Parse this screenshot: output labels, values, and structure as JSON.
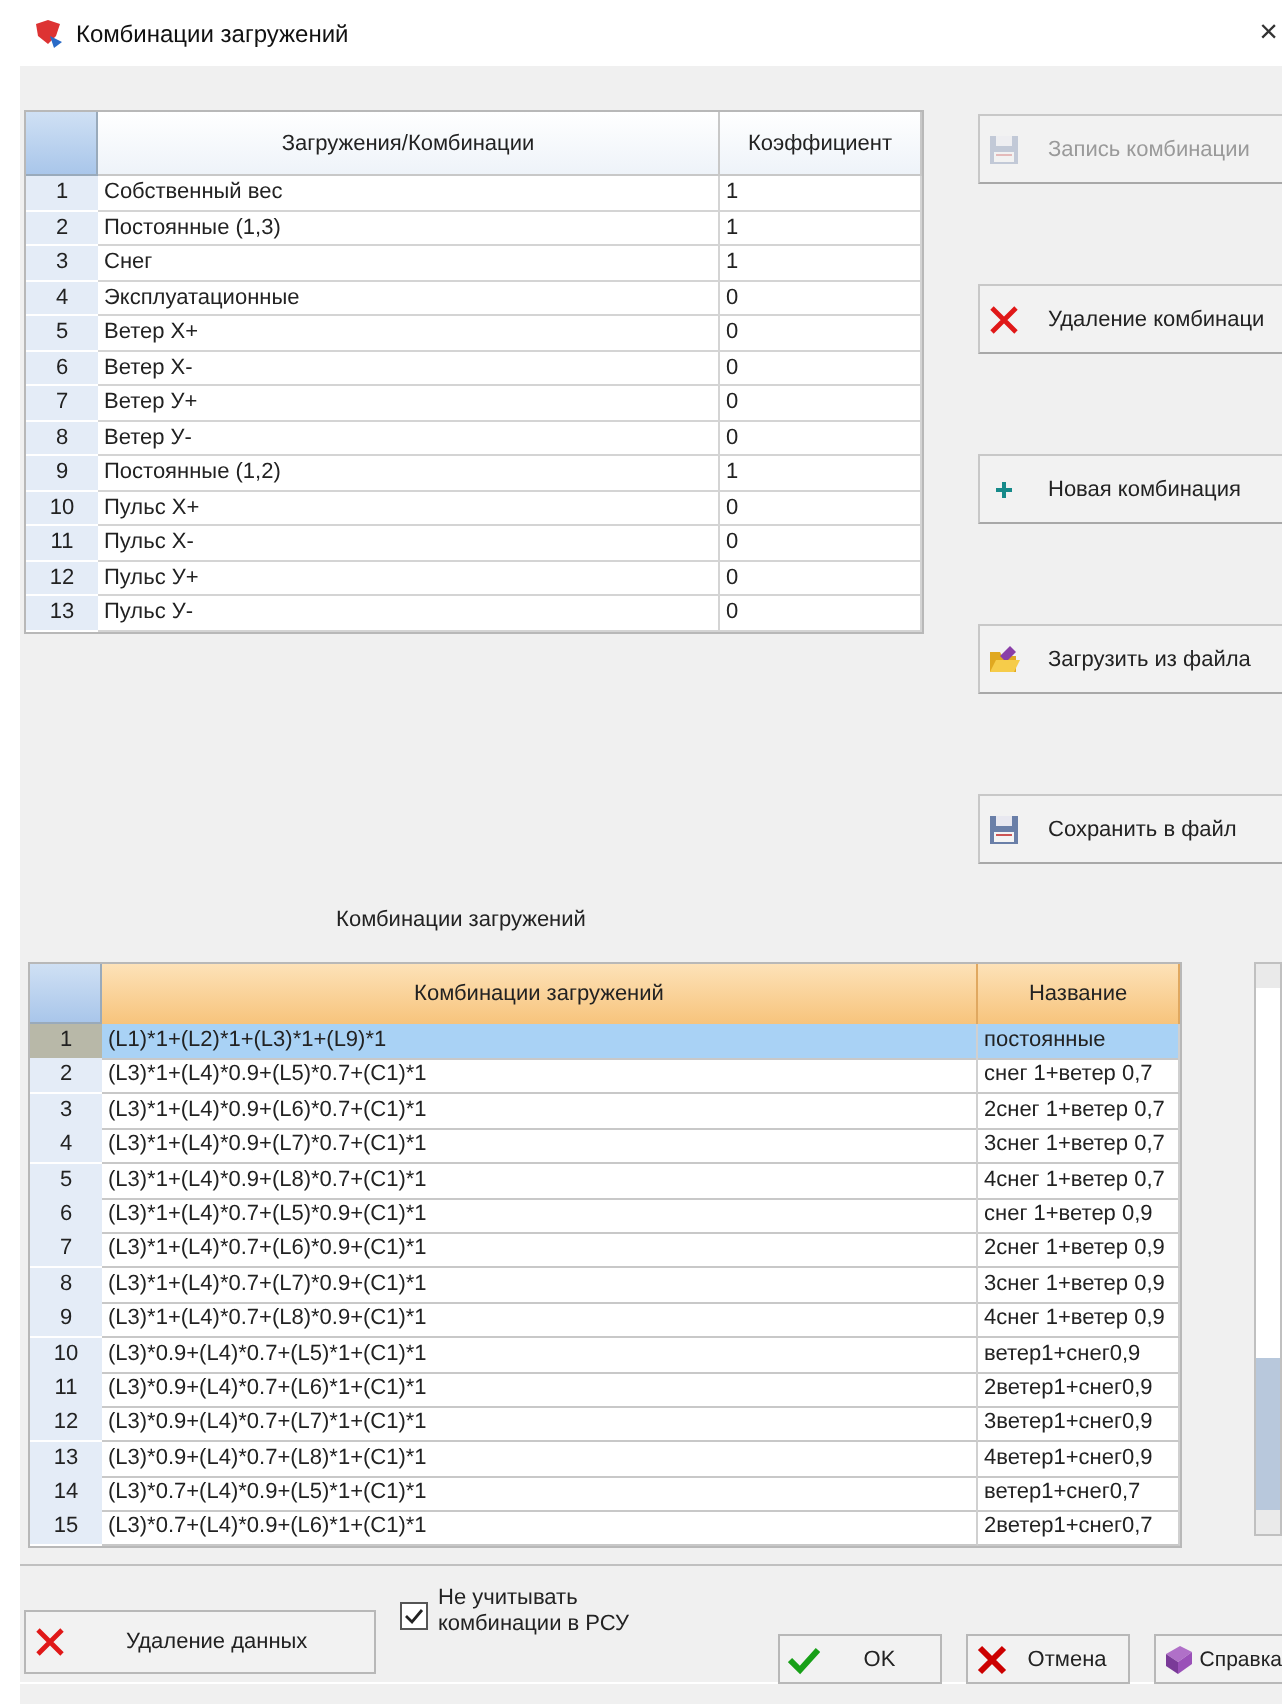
{
  "window": {
    "title": "Комбинации загружений",
    "close": "×"
  },
  "loads_table": {
    "columns": [
      "Загружения/Комбинации",
      "Коэффициент"
    ],
    "rows": [
      {
        "n": "1",
        "name": "Собственный вес",
        "factor": "1"
      },
      {
        "n": "2",
        "name": "Постоянные (1,3)",
        "factor": "1"
      },
      {
        "n": "3",
        "name": "Снег",
        "factor": "1"
      },
      {
        "n": "4",
        "name": "Эксплуатационные",
        "factor": "0"
      },
      {
        "n": "5",
        "name": "Ветер Х+",
        "factor": "0"
      },
      {
        "n": "6",
        "name": "Ветер Х-",
        "factor": "0"
      },
      {
        "n": "7",
        "name": "Ветер У+",
        "factor": "0"
      },
      {
        "n": "8",
        "name": "Ветер У-",
        "factor": "0"
      },
      {
        "n": "9",
        "name": "Постоянные (1,2)",
        "factor": "1"
      },
      {
        "n": "10",
        "name": "Пульс Х+",
        "factor": "0"
      },
      {
        "n": "11",
        "name": "Пульс Х-",
        "factor": "0"
      },
      {
        "n": "12",
        "name": "Пульс У+",
        "factor": "0"
      },
      {
        "n": "13",
        "name": "Пульс У-",
        "factor": "0"
      }
    ]
  },
  "side_buttons": [
    {
      "kind": "save",
      "label": "Запись комбинации",
      "disabled": true
    },
    {
      "kind": "delete",
      "label": "Удаление комбинаци",
      "disabled": false
    },
    {
      "kind": "add",
      "label": "Новая комбинация",
      "disabled": false
    },
    {
      "kind": "open",
      "label": "Загрузить из файла",
      "disabled": false
    },
    {
      "kind": "save",
      "label": "Сохранить в файл",
      "disabled": false
    }
  ],
  "combos_caption": "Комбинации загружений",
  "combos_table": {
    "columns": [
      "Комбинации загружений",
      "Название"
    ],
    "rows": [
      {
        "n": "1",
        "formula": "(L1)*1+(L2)*1+(L3)*1+(L9)*1",
        "name": "постоянные",
        "selected": true
      },
      {
        "n": "2",
        "formula": "(L3)*1+(L4)*0.9+(L5)*0.7+(C1)*1",
        "name": "снег 1+ветер 0,7",
        "selected": false
      },
      {
        "n": "3",
        "formula": "(L3)*1+(L4)*0.9+(L6)*0.7+(C1)*1",
        "name": "2снег 1+ветер 0,7",
        "selected": false
      },
      {
        "n": "4",
        "formula": "(L3)*1+(L4)*0.9+(L7)*0.7+(C1)*1",
        "name": "3снег 1+ветер 0,7",
        "selected": false
      },
      {
        "n": "5",
        "formula": "(L3)*1+(L4)*0.9+(L8)*0.7+(C1)*1",
        "name": "4снег 1+ветер 0,7",
        "selected": false
      },
      {
        "n": "6",
        "formula": "(L3)*1+(L4)*0.7+(L5)*0.9+(C1)*1",
        "name": "снег 1+ветер 0,9",
        "selected": false
      },
      {
        "n": "7",
        "formula": "(L3)*1+(L4)*0.7+(L6)*0.9+(C1)*1",
        "name": "2снег 1+ветер 0,9",
        "selected": false
      },
      {
        "n": "8",
        "formula": "(L3)*1+(L4)*0.7+(L7)*0.9+(C1)*1",
        "name": "3снег 1+ветер 0,9",
        "selected": false
      },
      {
        "n": "9",
        "formula": "(L3)*1+(L4)*0.7+(L8)*0.9+(C1)*1",
        "name": "4снег 1+ветер 0,9",
        "selected": false
      },
      {
        "n": "10",
        "formula": "(L3)*0.9+(L4)*0.7+(L5)*1+(C1)*1",
        "name": "ветер1+снег0,9",
        "selected": false
      },
      {
        "n": "11",
        "formula": "(L3)*0.9+(L4)*0.7+(L6)*1+(C1)*1",
        "name": "2ветер1+снег0,9",
        "selected": false
      },
      {
        "n": "12",
        "formula": "(L3)*0.9+(L4)*0.7+(L7)*1+(C1)*1",
        "name": "3ветер1+снег0,9",
        "selected": false
      },
      {
        "n": "13",
        "formula": "(L3)*0.9+(L4)*0.7+(L8)*1+(C1)*1",
        "name": "4ветер1+снег0,9",
        "selected": false
      },
      {
        "n": "14",
        "formula": "(L3)*0.7+(L4)*0.9+(L5)*1+(C1)*1",
        "name": "ветер1+снег0,7",
        "selected": false
      },
      {
        "n": "15",
        "formula": "(L3)*0.7+(L4)*0.9+(L6)*1+(C1)*1",
        "name": "2ветер1+снег0,7",
        "selected": false
      }
    ]
  },
  "bottom": {
    "delete_data": {
      "kind": "delete",
      "label": "Удаление данных"
    },
    "ignore_checkbox": {
      "label": "Не учитывать комбинации в РСУ",
      "checked": true
    },
    "buttons": [
      {
        "kind": "ok",
        "label": "OK"
      },
      {
        "kind": "cancel",
        "label": "Отмена"
      },
      {
        "kind": "help",
        "label": "Справка"
      }
    ]
  }
}
